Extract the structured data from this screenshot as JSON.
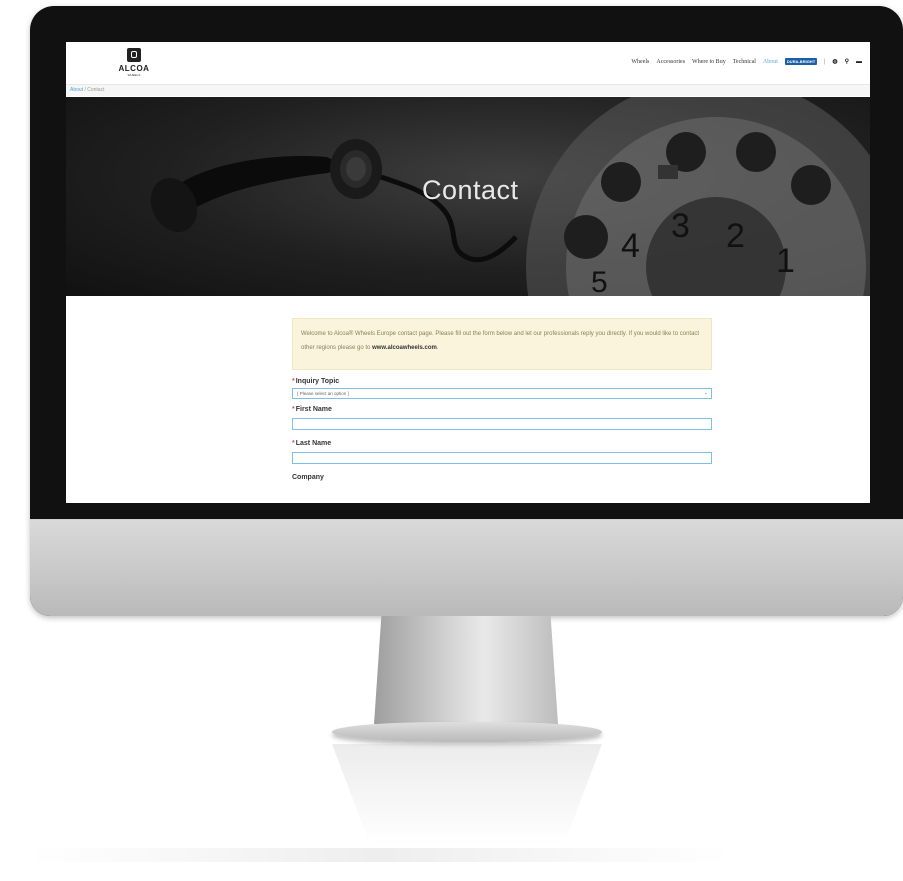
{
  "site": {
    "logo_text": "ALCOA",
    "logo_sub": "WHEELS"
  },
  "nav": {
    "items": [
      "Wheels",
      "Accessories",
      "Where to Buy",
      "Technical"
    ],
    "active_item": "About",
    "badge": "DURA-BRIGHT",
    "separator": "|",
    "icons": [
      "globe-icon",
      "search-icon",
      "flag-icon"
    ]
  },
  "breadcrumb": {
    "parent": "About",
    "separator": "/",
    "current": "Contact"
  },
  "hero": {
    "title": "Contact",
    "dial_digits": [
      "1",
      "2",
      "3",
      "4",
      "5"
    ]
  },
  "notice": {
    "text_1": "Welcome to Alcoa® Wheels Europe contact page. Please fill out the form below and let our professionals reply you directly. If you would like to contact other regions please go to",
    "link": "www.alcoawheels.com",
    "text_2": "."
  },
  "form": {
    "required_mark": "*",
    "inquiry_label": "Inquiry Topic",
    "inquiry_value": "{ Please select an option }",
    "first_name_label": "First Name",
    "first_name_value": "",
    "last_name_label": "Last Name",
    "last_name_value": "",
    "company_label": "Company"
  },
  "colors": {
    "accent": "#4da6d6",
    "notice_bg": "#fbf4dc",
    "required": "#d9534f",
    "field_border": "#7fc0e2"
  }
}
